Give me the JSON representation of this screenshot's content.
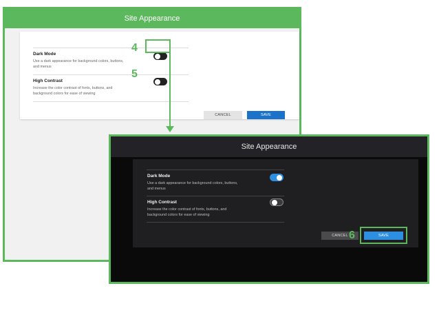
{
  "light": {
    "title": "Site Appearance",
    "dark_mode": {
      "label": "Dark Mode",
      "desc": "Use a dark appearance for background colors, buttons, and menus",
      "on": false
    },
    "high_contrast": {
      "label": "High Contrast",
      "desc": "Increase the color contrast of fonts, buttons, and background colors for ease of viewing",
      "on": false
    },
    "cancel": "CANCEL",
    "save": "SAVE"
  },
  "dark": {
    "title": "Site Appearance",
    "dark_mode": {
      "label": "Dark Mode",
      "desc": "Use a dark appearance for background colors, buttons, and menus",
      "on": true
    },
    "high_contrast": {
      "label": "High Contrast",
      "desc": "Increase the color contrast of fonts, buttons, and background colors for ease of viewing",
      "on": false
    },
    "cancel": "CANCEL",
    "save": "SAVE"
  },
  "steps": {
    "toggle_dark_mode": "4",
    "toggle_high_contrast": "5",
    "save": "6"
  },
  "colors": {
    "accent": "#5cb85c",
    "save_light": "#1a73c8",
    "save_dark": "#2e8fe0",
    "dark_bg": "#0a0a0a"
  }
}
